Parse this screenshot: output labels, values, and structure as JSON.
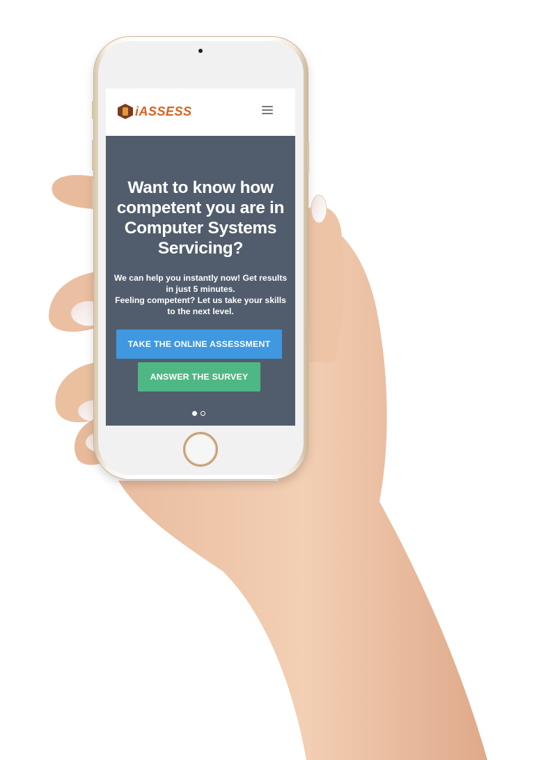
{
  "navbar": {
    "logo_text": "iASSESS"
  },
  "hero": {
    "title": "Want to know how competent you are in Computer Systems Servicing?",
    "description_line1": "We can help you instantly now! Get results in just 5 minutes.",
    "description_line2": "Feeling competent? Let us take your skills to the next level.",
    "primary_button": "TAKE THE ONLINE ASSESSMENT",
    "secondary_button": "ANSWER THE SURVEY",
    "slides_total": 2,
    "slide_active": 1
  },
  "colors": {
    "hero_background": "#515d6c",
    "primary_button": "#3f98e0",
    "secondary_button": "#4fb784",
    "logo_accent": "#d9611b"
  },
  "icons": {
    "menu": "hamburger-menu-icon",
    "logo": "hexagon-logo-icon"
  }
}
